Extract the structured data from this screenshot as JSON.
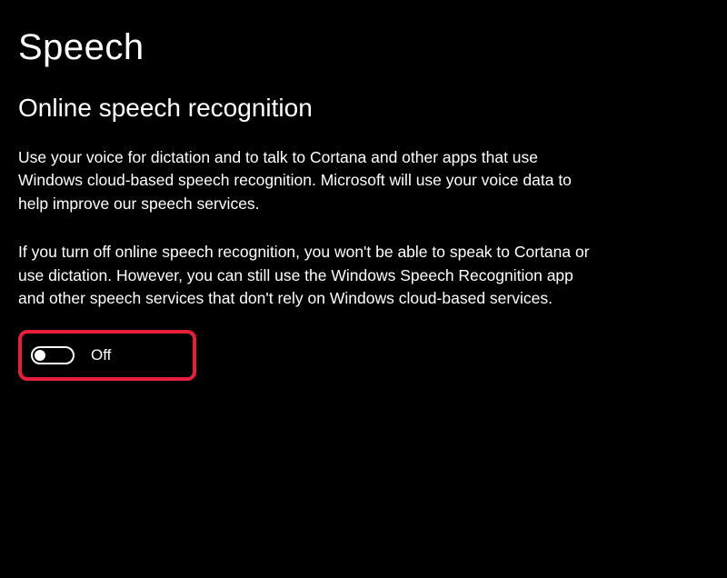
{
  "page": {
    "title": "Speech"
  },
  "section": {
    "title": "Online speech recognition",
    "description1": "Use your voice for dictation and to talk to Cortana and other apps that use Windows cloud-based speech recognition. Microsoft will use your voice data to help improve our speech services.",
    "description2": "If you turn off online speech recognition, you won't be able to speak to Cortana or use dictation. However, you can still use the Windows Speech Recognition app and other speech services that don't rely on Windows cloud-based services."
  },
  "toggle": {
    "state_label": "Off",
    "state": "off"
  },
  "highlight": {
    "color": "#e81e3a"
  }
}
